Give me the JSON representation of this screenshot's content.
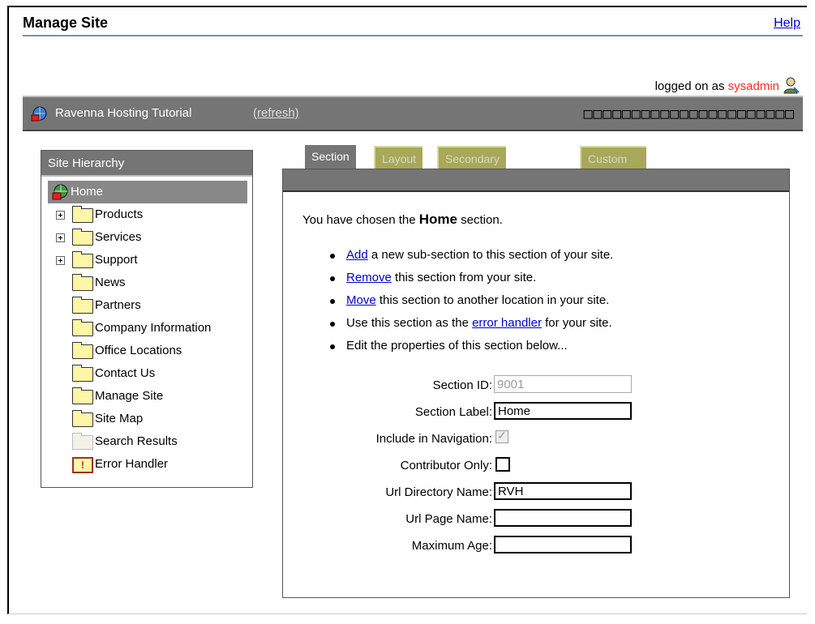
{
  "page": {
    "title": "Manage Site",
    "help": "Help"
  },
  "session": {
    "logged_prefix": "logged on as ",
    "user": "sysadmin"
  },
  "banner": {
    "site_name": "Ravenna Hosting Tutorial",
    "refresh": "(refresh)",
    "boxes": "□□□□□□□□□□□□□□□□□□□□□□"
  },
  "hierarchy": {
    "title": "Site Hierarchy",
    "items": [
      {
        "label": "Home",
        "kind": "home",
        "selected": true
      },
      {
        "label": "Products",
        "kind": "folder",
        "expandable": true
      },
      {
        "label": "Services",
        "kind": "folder",
        "expandable": true
      },
      {
        "label": "Support",
        "kind": "folder",
        "expandable": true
      },
      {
        "label": "News",
        "kind": "folder"
      },
      {
        "label": "Partners",
        "kind": "folder"
      },
      {
        "label": "Company Information",
        "kind": "folder"
      },
      {
        "label": "Office Locations",
        "kind": "folder"
      },
      {
        "label": "Contact Us",
        "kind": "folder"
      },
      {
        "label": "Manage Site",
        "kind": "folder"
      },
      {
        "label": "Site Map",
        "kind": "folder"
      },
      {
        "label": "Search Results",
        "kind": "empty-folder"
      },
      {
        "label": "Error Handler",
        "kind": "error"
      }
    ]
  },
  "tabs": [
    {
      "label": "Section",
      "active": true
    },
    {
      "label": "Layout",
      "active": false
    },
    {
      "label": "Secondary Layout",
      "active": false
    },
    {
      "label": "Custom Properties",
      "active": false
    }
  ],
  "section": {
    "intro_prefix": "You have chosen the ",
    "section_name": "Home",
    "intro_suffix": " section.",
    "actions": [
      {
        "link": "Add",
        "text": " a new sub-section to this section of your site."
      },
      {
        "link": "Remove",
        "text": " this section from your site."
      },
      {
        "link": "Move",
        "text": " this section to another location in your site."
      },
      {
        "prefix": "Use this section as the ",
        "link": "error handler",
        "text": " for your site."
      },
      {
        "text": "Edit the properties of this section below..."
      }
    ]
  },
  "form": {
    "section_id": {
      "label": "Section ID:",
      "value": "9001"
    },
    "section_label": {
      "label": "Section Label:",
      "value": "Home"
    },
    "include_nav": {
      "label": "Include in Navigation:",
      "checked": true
    },
    "contributor_only": {
      "label": "Contributor Only:",
      "checked": false
    },
    "url_dir": {
      "label": "Url Directory Name:",
      "value": "RVH"
    },
    "url_page": {
      "label": "Url Page Name:",
      "value": ""
    },
    "max_age": {
      "label": "Maximum Age:",
      "value": ""
    }
  },
  "colors": {
    "accent_link": "#0000cc",
    "user_name": "#ff2a2a",
    "header_gray": "#757575",
    "tab_inactive": "#a8a85a"
  }
}
